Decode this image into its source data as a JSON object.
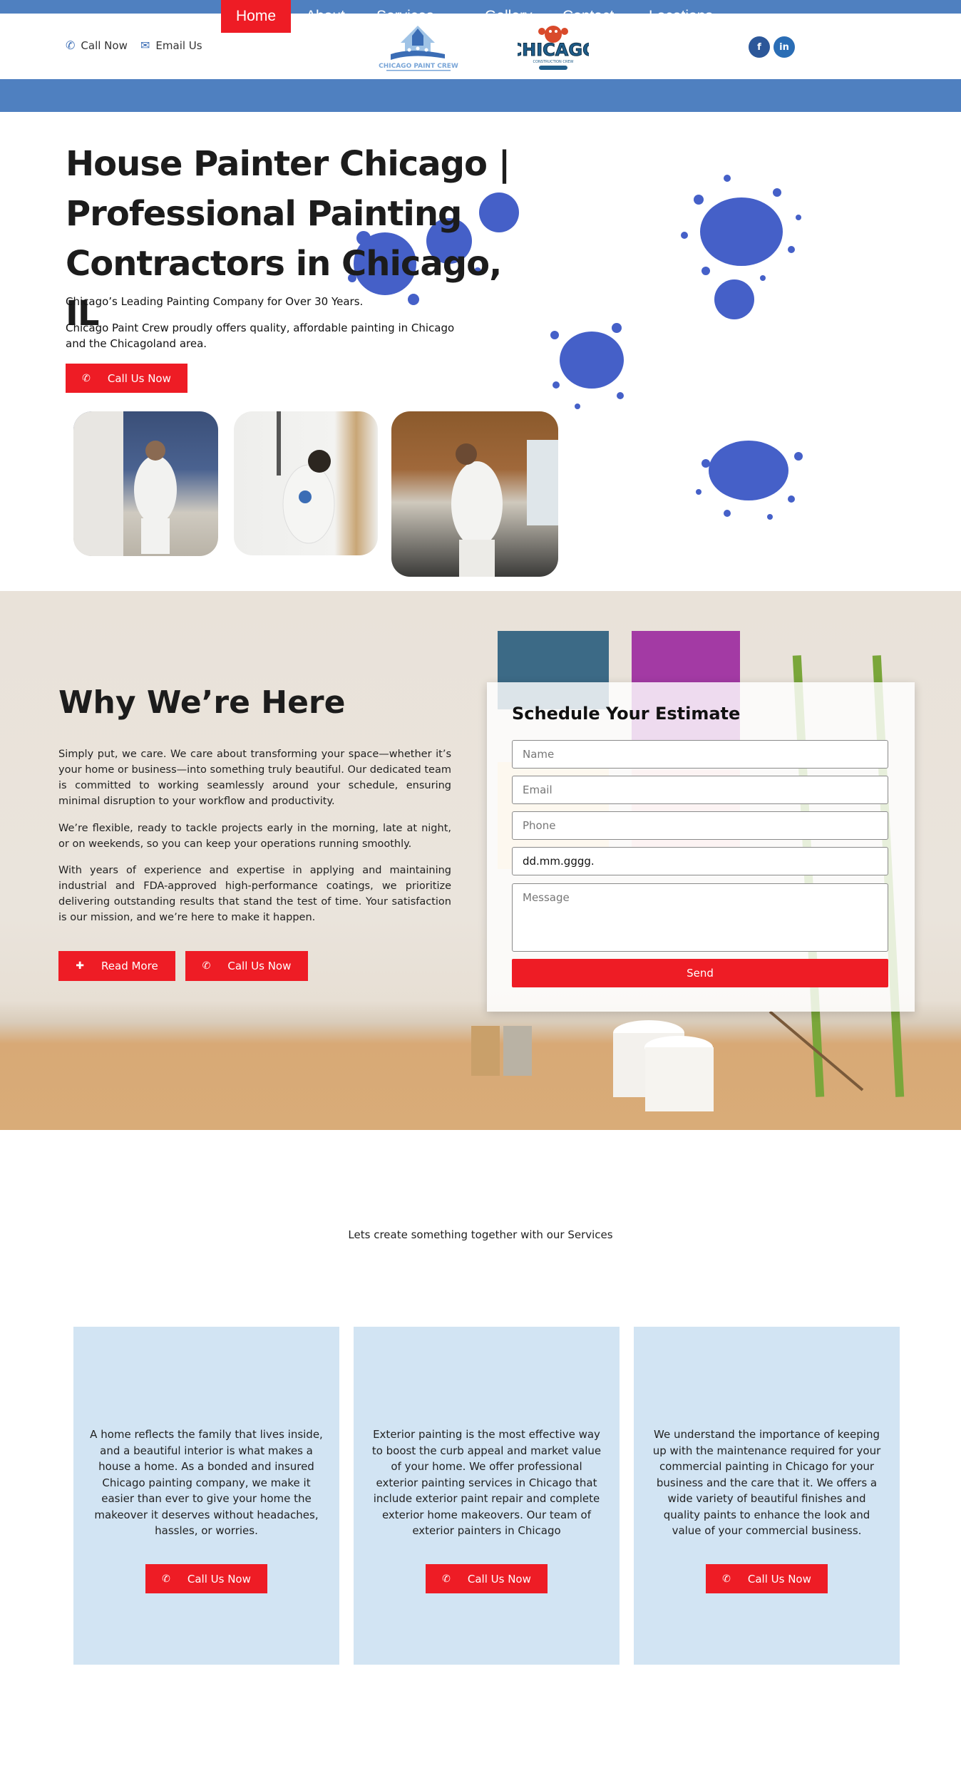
{
  "header": {
    "call_label": "Call Now",
    "email_label": "Email Us",
    "logo_left_text": "CHICAGO PAINT CREW",
    "logo_right_text": "CHICAGO",
    "logo_right_sub": "CONSTRUCTION CREW",
    "social": [
      "facebook-icon",
      "linkedin-icon"
    ]
  },
  "nav": {
    "items": [
      {
        "label": "Home",
        "active": true
      },
      {
        "label": "About"
      },
      {
        "label": "Services",
        "dropdown": true
      },
      {
        "label": "Gallery"
      },
      {
        "label": "Contact"
      },
      {
        "label": "Locations",
        "dropdown": true
      }
    ]
  },
  "hero": {
    "title": "House Painter Chicago | Professional Painting Contractors in Chicago, IL",
    "subtitle": "Chicago’s Leading Painting Company for Over 30 Years.",
    "description": "Chicago Paint Crew proudly offers quality, affordable painting in Chicago and the Chicagoland area.",
    "cta_label": "Call Us Now"
  },
  "why": {
    "title": "Why We’re Here",
    "paragraphs": [
      "Simply put, we care. We care about transforming your space—whether it’s your home or business—into something truly beautiful. Our dedicated team is committed to working seamlessly around your schedule, ensuring minimal disruption to your workflow and productivity.",
      "We’re flexible, ready to tackle projects early in the morning, late at night, or on weekends, so you can keep your operations running smoothly.",
      "With years of experience and expertise in applying and maintaining industrial and FDA-approved high-performance coatings, we prioritize delivering outstanding results that stand the test of time. Your satisfaction is our mission, and we’re here to make it happen."
    ],
    "read_more_label": "Read More",
    "call_label": "Call Us Now"
  },
  "form": {
    "title": "Schedule Your Estimate",
    "name_placeholder": "Name",
    "email_placeholder": "Email",
    "phone_placeholder": "Phone",
    "date_value": "dd.mm.gggg.",
    "message_placeholder": "Message",
    "send_label": "Send"
  },
  "services": {
    "tagline": "Lets create something together with our Services",
    "cards": [
      {
        "text": "A home reflects the family that lives inside, and a beautiful interior is what makes a house a home. As a bonded and insured Chicago painting company, we make it easier than ever to give your home the makeover it deserves without headaches, hassles, or worries.",
        "button": "Call Us Now"
      },
      {
        "text": "Exterior painting is the most effective way to boost the curb appeal and market value of your home. We offer professional exterior painting services in Chicago that include exterior paint repair and complete exterior home makeovers. Our team of exterior painters in Chicago",
        "button": "Call Us Now"
      },
      {
        "text": "We understand the importance of keeping up with the maintenance required for your commercial painting in Chicago for your business and the care that it. We offers a wide variety of beautiful finishes and quality paints to enhance the look and value of your commercial business.",
        "button": "Call Us Now"
      }
    ]
  },
  "colors": {
    "brand_blue": "#4f80c0",
    "accent_red": "#ee1c25",
    "splat_blue": "#4560c8",
    "card_blue": "#d2e4f3"
  }
}
